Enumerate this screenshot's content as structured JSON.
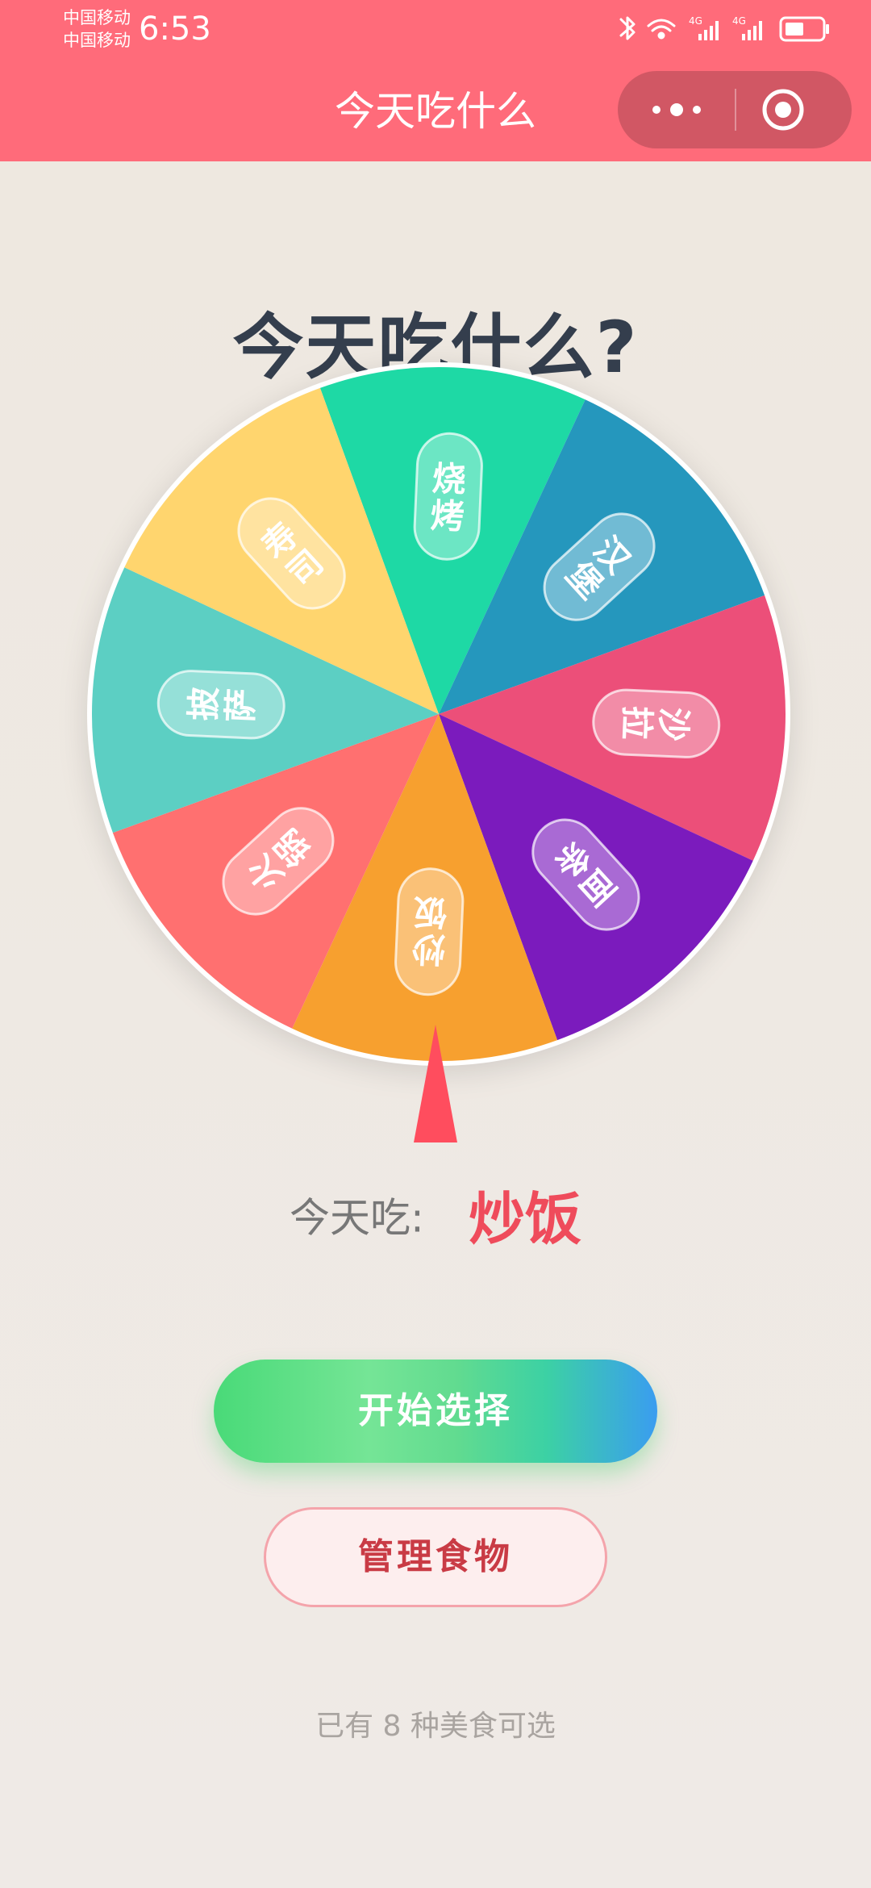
{
  "status_bar": {
    "carrier_1": "中国移动",
    "carrier_2": "中国移动",
    "time": "6:53",
    "icons": [
      "bluetooth-icon",
      "wifi-icon",
      "signal-4g-icon",
      "signal-4g-icon",
      "battery-icon"
    ],
    "network_label_1": "4G",
    "network_label_2": "4G"
  },
  "nav": {
    "title": "今天吃什么",
    "more_icon": "more-dots-icon",
    "close_icon": "target-close-icon"
  },
  "page": {
    "title": "今天吃什么?",
    "result_label": "今天吃:",
    "result_value": "炒饭",
    "start_button": "开始选择",
    "manage_button": "管理食物",
    "footer_note": "已有 8 种美食可选"
  },
  "wheel": {
    "items": [
      {
        "label": "烧烤",
        "color": "#1ed9a5"
      },
      {
        "label": "汉堡",
        "color": "#2597bd"
      },
      {
        "label": "沙拉",
        "color": "#ec4f79"
      },
      {
        "label": "面条",
        "color": "#7b1bbd"
      },
      {
        "label": "炒饭",
        "color": "#f7a02f"
      },
      {
        "label": "火锅",
        "color": "#ff7070"
      },
      {
        "label": "披萨",
        "color": "#5ccfc3"
      },
      {
        "label": "寿司",
        "color": "#ffd56e"
      }
    ]
  },
  "colors": {
    "nav_bg": "#ff6b7a",
    "accent": "#ef4b5b",
    "pointer": "#ff4d5e"
  }
}
